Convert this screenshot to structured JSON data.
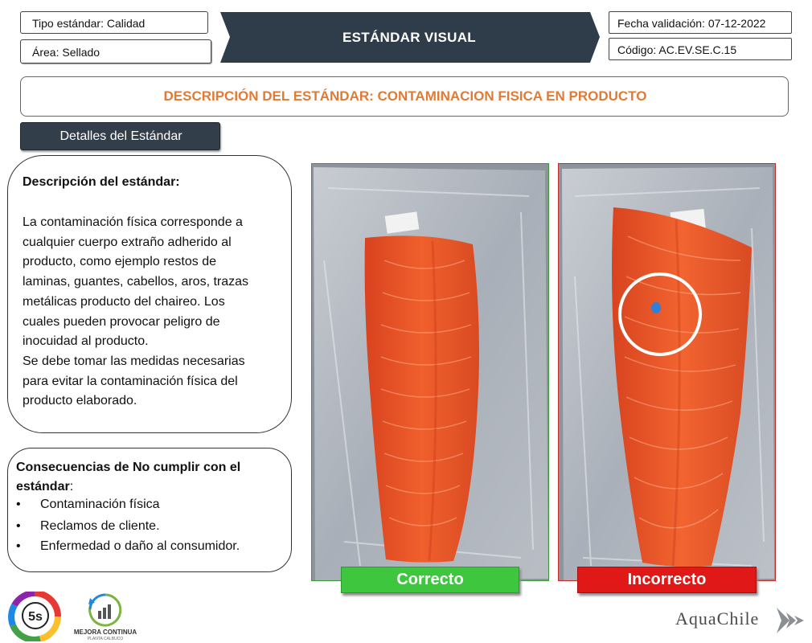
{
  "header": {
    "tipo": "Tipo estándar: Calidad",
    "area": "Área:  Sellado",
    "title": "ESTÁNDAR VISUAL",
    "fecha": "Fecha validación: 07-12-2022",
    "codigo": "Código: AC.EV.SE.C.15",
    "banner_color": "#2f3d4a"
  },
  "description_bar": {
    "title": "DESCRIPCIÓN DEL ESTÁNDAR: CONTAMINACION FISICA EN PRODUCTO",
    "title_color": "#e07a34"
  },
  "details_tab": {
    "label": "Detalles del Estándar"
  },
  "description": {
    "heading": "Descripción del estándar:",
    "lines": [
      "La contaminación física corresponde a",
      "cualquier cuerpo extraño adherido al",
      "producto, como ejemplo restos de",
      "laminas, guantes, cabellos, aros, trazas",
      "metálicas producto del chaireo. Los",
      "cuales pueden provocar peligro de",
      "inocuidad al producto.",
      "Se debe tomar las medidas necesarias",
      "para evitar la contaminación física del",
      "producto elaborado."
    ]
  },
  "consequences": {
    "heading_bold_1": "Consecuencias de No cumplir con el",
    "heading_bold_2": "estándar",
    "heading_suffix": ":",
    "items": [
      {
        "bullet": "•",
        "text": "Contaminación física"
      },
      {
        "bullet": "•",
        "text": "Reclamos de cliente."
      },
      {
        "bullet": "•",
        "text": "Enfermedad o daño al consumidor."
      }
    ]
  },
  "verdicts": {
    "correct": {
      "label": "Correcto",
      "color": "#3ec63e"
    },
    "incorrect": {
      "label": "Incorrecto",
      "color": "#e11818"
    }
  },
  "logos": {
    "five_s": "5s",
    "mejora": "MEJORA CONTINUA",
    "mejora_sub": "PLANTA CALBUCO",
    "brand": "AquaChile"
  }
}
